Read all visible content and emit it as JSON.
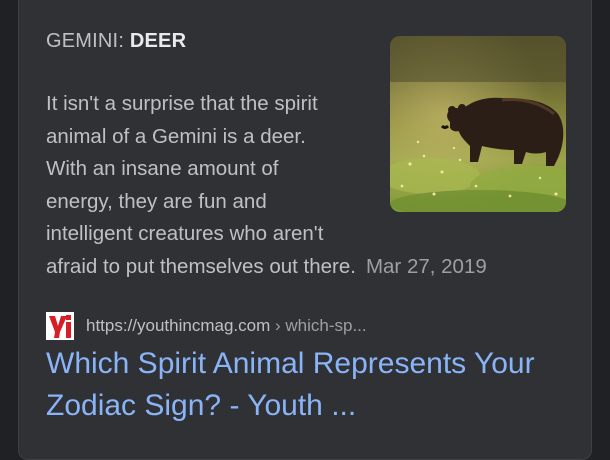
{
  "result": {
    "heading_prefix": "GEMINI:",
    "heading_bold": "DEER",
    "snippet_lines": [
      " It isn't a surprise that the spirit",
      "animal of a Gemini is a deer.",
      "With an insane amount of",
      "energy, they are fun and",
      "intelligent creatures who aren't",
      "afraid to put themselves out there."
    ],
    "date": "Mar 27, 2019",
    "thumbnail_icon": "bear-in-meadow-image",
    "source": {
      "favicon_letter": "yi",
      "domain": "https://youthincmag.com",
      "path": "› which-sp..."
    },
    "title_lines": [
      "Which Spirit Animal Represents Your",
      "Zodiac Sign? - Youth ..."
    ]
  },
  "colors": {
    "background": "#202124",
    "card": "#303134",
    "link": "#8ab4f8",
    "text": "#bdc1c6",
    "favicon_red": "#d62027"
  }
}
